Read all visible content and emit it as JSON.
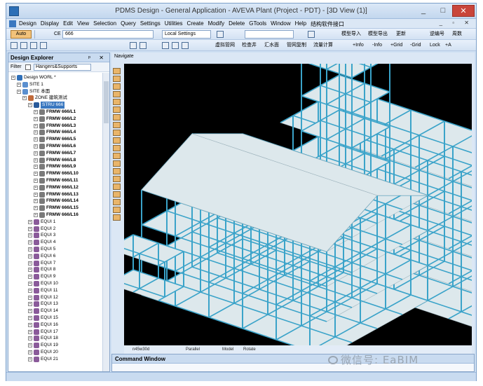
{
  "window": {
    "title": "PDMS Design - General Application - AVEVA Plant (Project - PDT) - [3D View (1)]",
    "min_label": "_",
    "max_label": "□",
    "close_label": "✕"
  },
  "menu": {
    "items": [
      "Design",
      "Display",
      "Edit",
      "View",
      "Selection",
      "Query",
      "Settings",
      "Utilities",
      "Create",
      "Modify",
      "Delete",
      "GTools",
      "Window",
      "Help",
      "结构软件接口"
    ],
    "mdi_controls": "_ ▫ ✕"
  },
  "toolbar1": {
    "auto_label": "Auto",
    "ce_label": "CE",
    "ce_value": "666",
    "settings_value": "Local Settings",
    "buttons": [
      "模型导入",
      "模型导出",
      "更新",
      "逆编号",
      "周数"
    ]
  },
  "toolbar2": {
    "buttons": [
      "虚拟管网",
      "检查井",
      "汇水面",
      "管网复制",
      "流量计算",
      "+Info",
      "-Info",
      "+Grid",
      "-Grid",
      "Lock",
      "+A"
    ]
  },
  "explorer": {
    "title": "Design Explorer",
    "controls": "ᵖ ✕",
    "filter_label": "Filter",
    "filter_value": "Hangers&Supports",
    "tree": [
      {
        "label": "Design WORL *",
        "indent": 0,
        "icon": "globe"
      },
      {
        "label": "SITE 1",
        "indent": 1,
        "icon": "site"
      },
      {
        "label": "SITE 本面",
        "indent": 1,
        "icon": "site"
      },
      {
        "label": "ZONE 建筑测试",
        "indent": 2,
        "icon": "zone"
      },
      {
        "label": "STRU 666",
        "indent": 3,
        "icon": "stru",
        "selected": true
      },
      {
        "label": "FRMW 666/L1",
        "indent": 4,
        "icon": "frmw",
        "bold": true
      },
      {
        "label": "FRMW 666/L2",
        "indent": 4,
        "icon": "frmw",
        "bold": true
      },
      {
        "label": "FRMW 666/L3",
        "indent": 4,
        "icon": "frmw",
        "bold": true
      },
      {
        "label": "FRMW 666/L4",
        "indent": 4,
        "icon": "frmw",
        "bold": true
      },
      {
        "label": "FRMW 666/L5",
        "indent": 4,
        "icon": "frmw",
        "bold": true
      },
      {
        "label": "FRMW 666/L6",
        "indent": 4,
        "icon": "frmw",
        "bold": true
      },
      {
        "label": "FRMW 666/L7",
        "indent": 4,
        "icon": "frmw",
        "bold": true
      },
      {
        "label": "FRMW 666/L8",
        "indent": 4,
        "icon": "frmw",
        "bold": true
      },
      {
        "label": "FRMW 666/L9",
        "indent": 4,
        "icon": "frmw",
        "bold": true
      },
      {
        "label": "FRMW 666/L10",
        "indent": 4,
        "icon": "frmw",
        "bold": true
      },
      {
        "label": "FRMW 666/L11",
        "indent": 4,
        "icon": "frmw",
        "bold": true
      },
      {
        "label": "FRMW 666/L12",
        "indent": 4,
        "icon": "frmw",
        "bold": true
      },
      {
        "label": "FRMW 666/L13",
        "indent": 4,
        "icon": "frmw",
        "bold": true
      },
      {
        "label": "FRMW 666/L14",
        "indent": 4,
        "icon": "frmw",
        "bold": true
      },
      {
        "label": "FRMW 666/L15",
        "indent": 4,
        "icon": "frmw",
        "bold": true
      },
      {
        "label": "FRMW 666/L16",
        "indent": 4,
        "icon": "frmw",
        "bold": true
      },
      {
        "label": "EQUI 1",
        "indent": 3,
        "icon": "equi"
      },
      {
        "label": "EQUI 2",
        "indent": 3,
        "icon": "equi"
      },
      {
        "label": "EQUI 3",
        "indent": 3,
        "icon": "equi"
      },
      {
        "label": "EQUI 4",
        "indent": 3,
        "icon": "equi"
      },
      {
        "label": "EQUI 5",
        "indent": 3,
        "icon": "equi"
      },
      {
        "label": "EQUI 6",
        "indent": 3,
        "icon": "equi"
      },
      {
        "label": "EQUI 7",
        "indent": 3,
        "icon": "equi"
      },
      {
        "label": "EQUI 8",
        "indent": 3,
        "icon": "equi"
      },
      {
        "label": "EQUI 9",
        "indent": 3,
        "icon": "equi"
      },
      {
        "label": "EQUI 10",
        "indent": 3,
        "icon": "equi"
      },
      {
        "label": "EQUI 11",
        "indent": 3,
        "icon": "equi"
      },
      {
        "label": "EQUI 12",
        "indent": 3,
        "icon": "equi"
      },
      {
        "label": "EQUI 13",
        "indent": 3,
        "icon": "equi"
      },
      {
        "label": "EQUI 14",
        "indent": 3,
        "icon": "equi"
      },
      {
        "label": "EQUI 15",
        "indent": 3,
        "icon": "equi"
      },
      {
        "label": "EQUI 16",
        "indent": 3,
        "icon": "equi"
      },
      {
        "label": "EQUI 17",
        "indent": 3,
        "icon": "equi"
      },
      {
        "label": "EQUI 18",
        "indent": 3,
        "icon": "equi"
      },
      {
        "label": "EQUI 19",
        "indent": 3,
        "icon": "equi"
      },
      {
        "label": "EQUI 20",
        "indent": 3,
        "icon": "equi"
      },
      {
        "label": "EQUI 21",
        "indent": 3,
        "icon": "equi"
      }
    ]
  },
  "view": {
    "nav_label": "Navigate",
    "status": {
      "direction": "n45w30d",
      "projection": "Parallel",
      "mode": "Model",
      "action": "Rotate"
    },
    "colors": {
      "background": "#000000",
      "steel": "#3aa3c9",
      "slab": "#dde8ec"
    }
  },
  "command_window": {
    "title": "Command Window"
  },
  "watermark": {
    "text": "微信号: EaBIM"
  }
}
